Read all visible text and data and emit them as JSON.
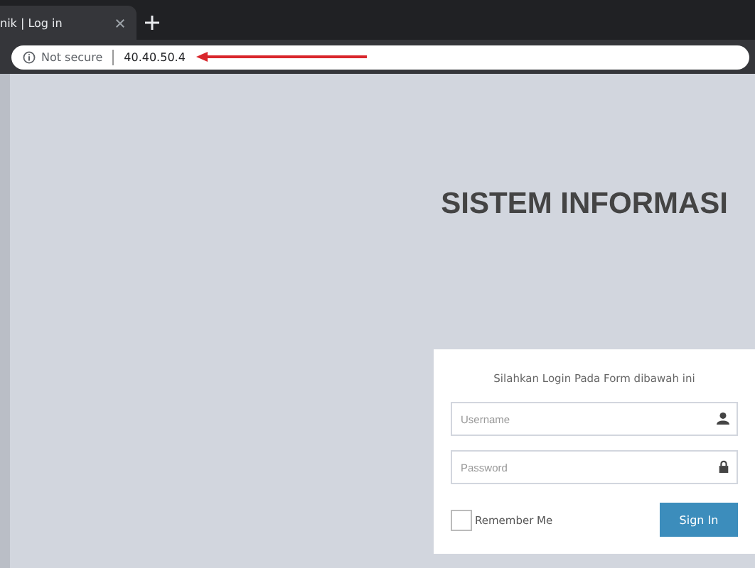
{
  "browser": {
    "tab": {
      "title": "nik | Log in",
      "selected": true
    },
    "address": {
      "security": "Not secure",
      "url": "40.40.50.4"
    }
  },
  "page": {
    "title": "SISTEM INFORMASI",
    "login": {
      "message": "Silahkan Login Pada Form dibawah ini",
      "username": {
        "placeholder": "Username"
      },
      "password": {
        "placeholder": "Password"
      },
      "remember": {
        "label": "Remember Me",
        "checked": false
      },
      "submit": "Sign In"
    }
  }
}
